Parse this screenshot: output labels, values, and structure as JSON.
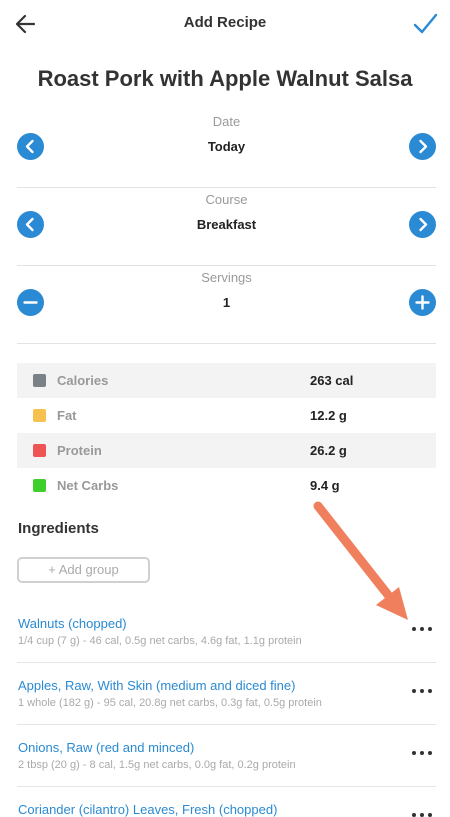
{
  "header": {
    "title": "Add Recipe",
    "back_icon": "arrow-left-icon",
    "confirm_icon": "checkmark-icon"
  },
  "recipe": {
    "title": "Roast Pork with Apple Walnut Salsa"
  },
  "date": {
    "label": "Date",
    "value": "Today"
  },
  "course": {
    "label": "Course",
    "value": "Breakfast"
  },
  "servings": {
    "label": "Servings",
    "value": "1"
  },
  "nutrition": [
    {
      "label": "Calories",
      "value": "263 cal",
      "color": "#7a8288"
    },
    {
      "label": "Fat",
      "value": "12.2 g",
      "color": "#f6c14e"
    },
    {
      "label": "Protein",
      "value": "26.2 g",
      "color": "#ef5454"
    },
    {
      "label": "Net Carbs",
      "value": "9.4 g",
      "color": "#3ecf2b"
    }
  ],
  "ingredients": {
    "heading": "Ingredients",
    "add_group_label": "+ Add group",
    "items": [
      {
        "name": "Walnuts (chopped)",
        "desc": "1/4 cup (7 g) - 46 cal, 0.5g net carbs, 4.6g fat, 1.1g protein"
      },
      {
        "name": "Apples, Raw, With Skin (medium and diced fine)",
        "desc": "1 whole (182 g) - 95 cal, 20.8g net carbs, 0.3g fat, 0.5g protein"
      },
      {
        "name": "Onions, Raw (red and minced)",
        "desc": "2 tbsp (20 g) - 8 cal, 1.5g net carbs, 0.0g fat, 0.2g protein"
      },
      {
        "name": "Coriander (cilantro) Leaves, Fresh (chopped)",
        "desc": ""
      }
    ]
  },
  "colors": {
    "accent": "#2a8ad3",
    "annotation_arrow": "#f07f5e"
  }
}
